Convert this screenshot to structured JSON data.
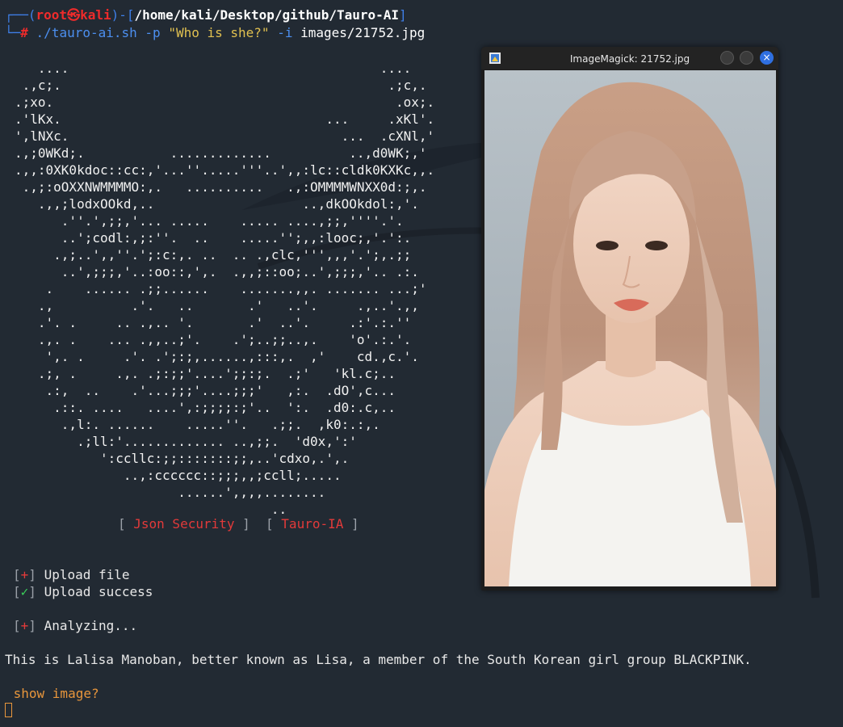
{
  "prompt": {
    "user": "root",
    "at": "㉿",
    "host": "kali",
    "cwd": "/home/kali/Desktop/github/Tauro-AI",
    "hash": "#",
    "command": "./tauro-ai.sh",
    "flag_p": "-p",
    "question": "\"Who is she?\"",
    "flag_i": "-i",
    "image_path": "images/21752.jpg"
  },
  "ascii_art": "   ....                                        ....\n .,c;.                                          .;c,.\n.;xo.                                            .ox;.\n.'lKx.                                  ...     .xKl'.\n',lNXc.                                   ...  .cXNl,'\n.,;0WKd;.           .............          ..,d0WK;,'\n.,,:0XK0kdoc::cc:,'...''.....'''..',,:lc::cldk0KXKc,,.\n .,;:oOXXNWMMMMO:,.   ..........   .,:OMMMMWNXX0d:;,.\n   .,,;lodxOOkd,..                   ..,dkOOkdol:,'.\n      .''.',;;,'... .....    ..... ....,;;,''''.'.\n      ..';codl:,;:''.  ..    .....'';,,:looc;,'.':.\n     .,;..',,''.';:c:,. ..  .. .,clc,''',,,'.';,.;;\n      ..',;;;,'..:oo::,',.  .,,;::oo;..',;;;,'.. .:.\n    .    ...... .;;......    .......,,. ....... ...;'\n   .,          .'.   ..       .'   ..'.     .,..'.,,\n   .'. .     .. .,.. '.       .'  ..'.     .:'.:.''\n   .,. .    ... .,,..;'.    .';..;;..,.    'o'.:.'.\n    ',. .     .'. .';:;,......,:::,.  ,'    cd.,c.'.\n   .;, .     .,. .;:;;'....';;:;.  .;'   'kl.c;..\n    .:,  ..    .'...;;;'....;;;'   ,:.  .dO',c...\n     .::. ....   ....',:;;;;:;'..  ':.  .d0:.c,..\n      .,l:. ......    .....''.   .;;.  ,k0:.:,.\n        .;ll:'............. ..,;;.  'd0x,':'\n           ':ccllc:;;:::::::;;,..'cdxo,.',.\n              ..,:cccccc::;;;,,;ccll;.....\n                     ......',,,,........\n                                 ..",
  "banner": {
    "left": "Json Security",
    "right": "Tauro-IA"
  },
  "log": {
    "upload_mark": "+",
    "upload_text": "Upload file",
    "success_mark": "✓",
    "success_text": "Upload success",
    "analyze_mark": "+",
    "analyze_text": "Analyzing...",
    "result": "This is Lalisa Manoban, better known as Lisa, a member of the South Korean girl group BLACKPINK.",
    "question": " show image?"
  },
  "window": {
    "title": "ImageMagick: 21752.jpg",
    "close_glyph": "×"
  },
  "colors": {
    "terminal_bg": "#222a33",
    "prompt_blue": "#3f7fe8",
    "prompt_red": "#ee2b2b",
    "string_yellow": "#e0c050",
    "success_green": "#3bd35a",
    "question_orange": "#e8963c"
  }
}
